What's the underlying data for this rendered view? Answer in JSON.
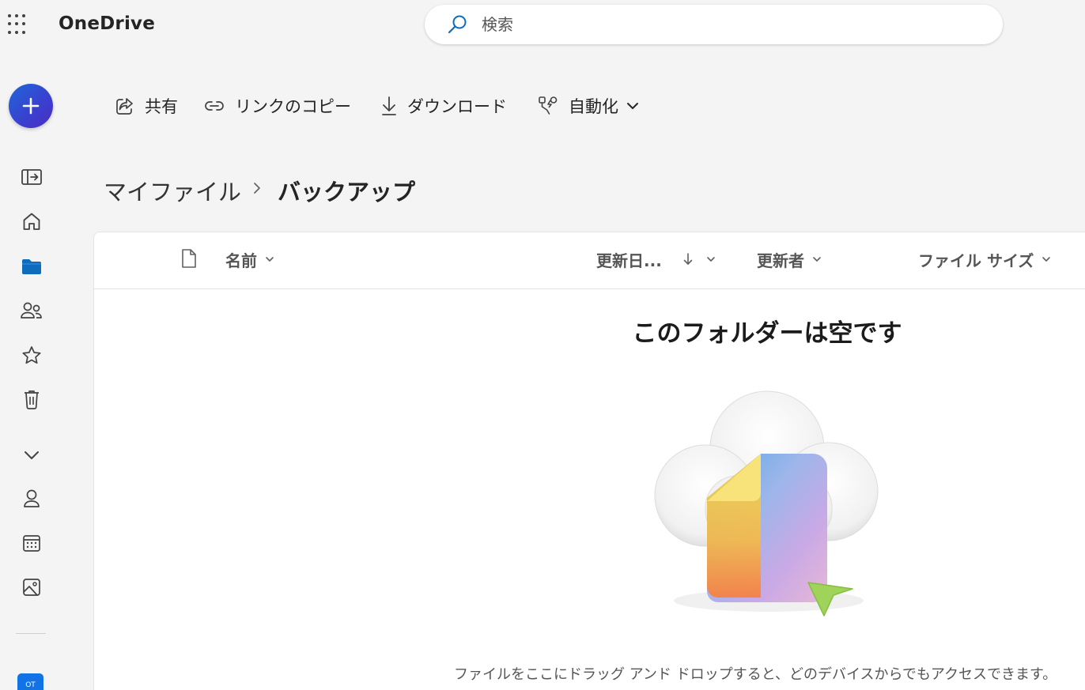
{
  "app": {
    "title": "OneDrive"
  },
  "search": {
    "placeholder": "検索"
  },
  "toolbar": {
    "share": "共有",
    "copy_link": "リンクのコピー",
    "download": "ダウンロード",
    "automate": "自動化"
  },
  "breadcrumb": {
    "root": "マイファイル",
    "current": "バックアップ"
  },
  "columns": {
    "name": "名前",
    "modified": "更新日...",
    "modified_by": "更新者",
    "file_size": "ファイル サイズ"
  },
  "empty": {
    "title": "このフォルダーは空です",
    "description": "ファイルをここにドラッグ アンド ドロップすると、どのデバイスからでもアクセスできます。"
  },
  "rail": {
    "avatar_initials": "OT"
  },
  "colors": {
    "accent": "#0f6cbd",
    "create_button": "#3a3fcf",
    "avatar": "#1173e6"
  },
  "icons": [
    "app-launcher-icon",
    "search-icon",
    "plus-icon",
    "collapse-nav-icon",
    "home-icon",
    "folder-icon",
    "people-icon",
    "star-icon",
    "trash-icon",
    "chevron-down-icon",
    "person-icon",
    "calendar-icon",
    "photo-icon",
    "share-icon",
    "link-icon",
    "download-icon",
    "automate-icon",
    "file-icon",
    "sort-arrow-down-icon"
  ]
}
